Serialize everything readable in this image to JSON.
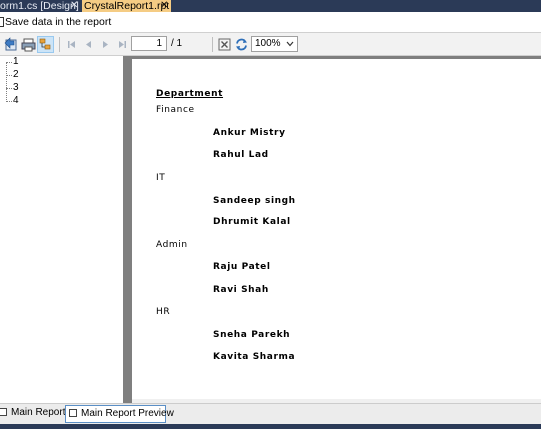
{
  "tabs": [
    {
      "label": "orm1.cs [Design]",
      "close": "✕",
      "active": false
    },
    {
      "label": "CrystalReport1.rpt",
      "close": "✕",
      "active": true
    }
  ],
  "save_bar": {
    "label": "Save data in the report",
    "checked": false
  },
  "toolbar": {
    "icons": [
      "export-icon",
      "print-icon",
      "group-tree-toggle-icon",
      "first-page-icon",
      "previous-page-icon",
      "next-page-icon",
      "last-page-icon",
      "stop-icon",
      "refresh-icon"
    ],
    "page_current": "1",
    "page_total": "/ 1",
    "zoom": "100%"
  },
  "group_tree": {
    "items": [
      "1",
      "2",
      "3",
      "4"
    ]
  },
  "report": {
    "header": "Department",
    "groups": [
      {
        "department": "Finance",
        "employees": [
          "Ankur Mistry",
          "Rahul Lad"
        ]
      },
      {
        "department": "IT",
        "employees": [
          "Sandeep singh",
          "Dhrumit Kalal"
        ]
      },
      {
        "department": "Admin",
        "employees": [
          "Raju Patel",
          "Ravi Shah"
        ]
      },
      {
        "department": "HR",
        "employees": [
          "Sneha Parekh",
          "Kavita Sharma"
        ]
      }
    ]
  },
  "bottom_tabs": [
    {
      "label": "Main Report",
      "active": false
    },
    {
      "label": "Main Report Preview",
      "active": true
    }
  ],
  "colors": {
    "tab_strip": "#2b3a57",
    "active_tab": "#f5cc84",
    "report_background": "#7f7f7f"
  }
}
